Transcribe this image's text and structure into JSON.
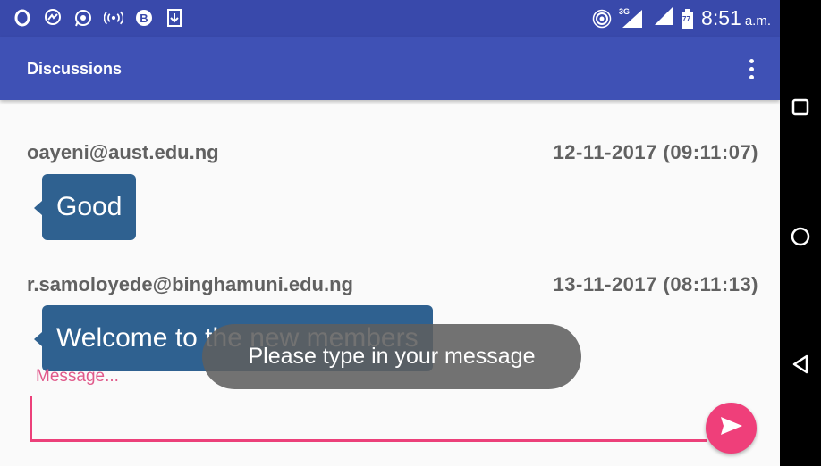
{
  "status_bar": {
    "left_icons": [
      "opera-icon",
      "messenger-icon",
      "whatsapp-icon",
      "hotspot-icon",
      "bitcoin-icon",
      "download-icon"
    ],
    "network_label": "3G",
    "battery_label": "77",
    "time": "8:51",
    "ampm": "a.m."
  },
  "app_bar": {
    "title": "Discussions"
  },
  "messages": [
    {
      "sender": "oayeni@aust.edu.ng",
      "timestamp": "12-11-2017 (09:11:07)",
      "text": "Good"
    },
    {
      "sender": "r.samoloyede@binghamuni.edu.ng",
      "timestamp": "13-11-2017 (08:11:13)",
      "text": "Welcome to the new members"
    }
  ],
  "composer": {
    "label": "Message...",
    "value": ""
  },
  "toast": {
    "text": "Please type in your message"
  },
  "colors": {
    "status_bar": "#3949ab",
    "app_bar": "#3f51b5",
    "bubble": "#2f6190",
    "accent": "#ec407a",
    "toast": "#5f5f5f"
  }
}
